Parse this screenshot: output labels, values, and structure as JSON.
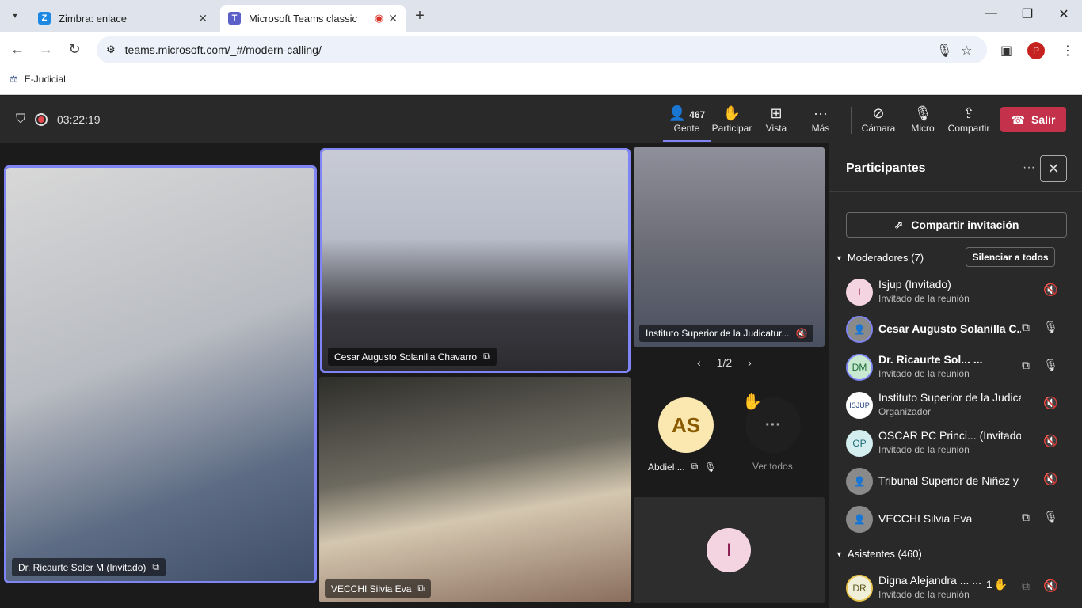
{
  "browser": {
    "tabs": [
      {
        "title": "Zimbra: enlace",
        "favicon": "Z"
      },
      {
        "title": "Microsoft Teams classic"
      }
    ],
    "url": "teams.microsoft.com/_#/modern-calling/",
    "bookmark": "E-Judicial",
    "profile_initial": "P"
  },
  "meeting": {
    "timer": "03:22:19",
    "people_count": "467",
    "buttons": {
      "people": "Gente",
      "participate": "Participar",
      "view": "Vista",
      "more": "Más",
      "camera": "Cámara",
      "mic": "Micro",
      "share": "Compartir",
      "leave": "Salir"
    }
  },
  "stage": {
    "tiles": [
      {
        "name": "Dr. Ricaurte Soler M (Invitado)"
      },
      {
        "name": "Cesar Augusto Solanilla Chavarro"
      },
      {
        "name": "Instituto Superior de la Judicatur..."
      },
      {
        "name": "VECCHI Silvia Eva"
      }
    ],
    "pager": "1/2",
    "avatar_tiles": [
      {
        "initials": "AS",
        "name": "Abdiel ..."
      },
      {
        "name": "Ver todos"
      }
    ],
    "bottom_tile_initial": "I"
  },
  "panel": {
    "title": "Participantes",
    "share_invite": "Compartir invitación",
    "moderators_label": "Moderadores (7)",
    "mute_all": "Silenciar a todos",
    "attendees_label": "Asistentes (460)",
    "moderators": [
      {
        "initials": "I",
        "name": "Isjup (Invitado)",
        "sub": "Invitado de la reunión"
      },
      {
        "initials": "",
        "name": "Cesar Augusto Solanilla C...",
        "sub": ""
      },
      {
        "initials": "DM",
        "name": "Dr. Ricaurte Sol...   ...",
        "sub": "Invitado de la reunión"
      },
      {
        "initials": "",
        "name": "Instituto Superior de la Judicat...",
        "sub": "Organizador"
      },
      {
        "initials": "OP",
        "name": "OSCAR PC Princi... (Invitado)",
        "sub": "Invitado de la reunión"
      },
      {
        "initials": "",
        "name": "Tribunal Superior de Niñez y A...",
        "sub": ""
      },
      {
        "initials": "",
        "name": "VECCHI Silvia Eva",
        "sub": ""
      }
    ],
    "attendees": [
      {
        "initials": "DR",
        "name": "Digna Alejandra ... ...",
        "sub": "Invitado de la reunión",
        "hand_count": "1"
      }
    ]
  }
}
